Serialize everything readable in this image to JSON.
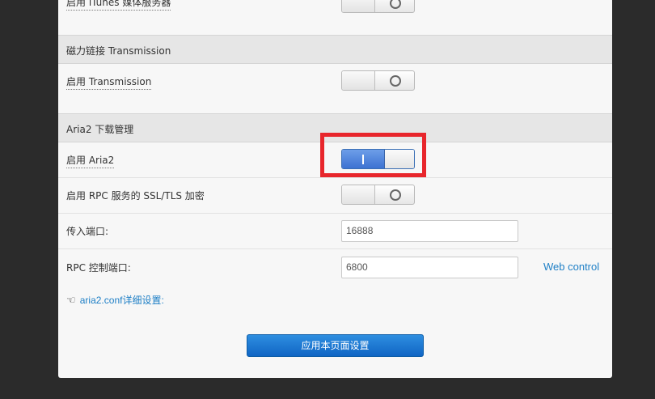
{
  "itunes": {
    "label": "启用 iTunes 媒体服务器",
    "enabled": false
  },
  "transmission": {
    "section_title": "磁力链接 Transmission",
    "enable_label": "启用 Transmission",
    "enabled": false
  },
  "aria2": {
    "section_title": "Aria2 下载管理",
    "enable_label": "启用 Aria2",
    "enabled": true,
    "ssl_label": "启用 RPC 服务的 SSL/TLS 加密",
    "ssl_enabled": false,
    "incoming_port_label": "传入端口:",
    "incoming_port_value": "16888",
    "rpc_port_label": "RPC 控制端口:",
    "rpc_port_value": "6800",
    "web_control_link": "Web control",
    "conf_link": "aria2.conf详细设置:",
    "conf_icon": "pointing-hand-icon"
  },
  "apply_button": "应用本页面设置",
  "colors": {
    "highlight": "#e8262c",
    "toggle_on": "#3d72d2",
    "link": "#1e7fc6"
  }
}
